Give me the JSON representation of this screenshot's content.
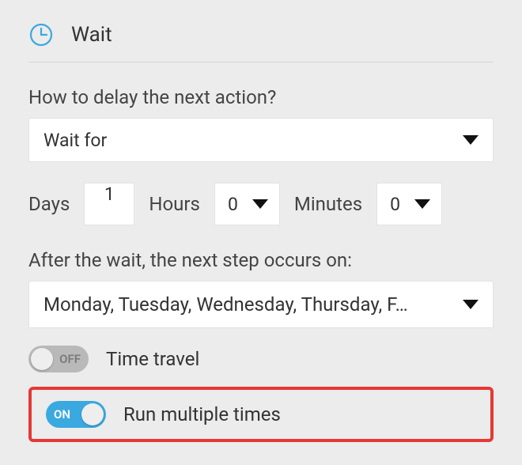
{
  "header": {
    "title": "Wait"
  },
  "delay": {
    "question": "How to delay the next action?",
    "mode_selected": "Wait for",
    "days_label": "Days",
    "days_value": "1",
    "hours_label": "Hours",
    "hours_value": "0",
    "minutes_label": "Minutes",
    "minutes_value": "0"
  },
  "after": {
    "label": "After the wait, the next step occurs on:",
    "days_selected": "Monday, Tuesday, Wednesday, Thursday, F…"
  },
  "toggles": {
    "time_travel": {
      "label": "Time travel",
      "state_text": "OFF"
    },
    "run_multiple": {
      "label": "Run multiple times",
      "state_text": "ON"
    }
  }
}
